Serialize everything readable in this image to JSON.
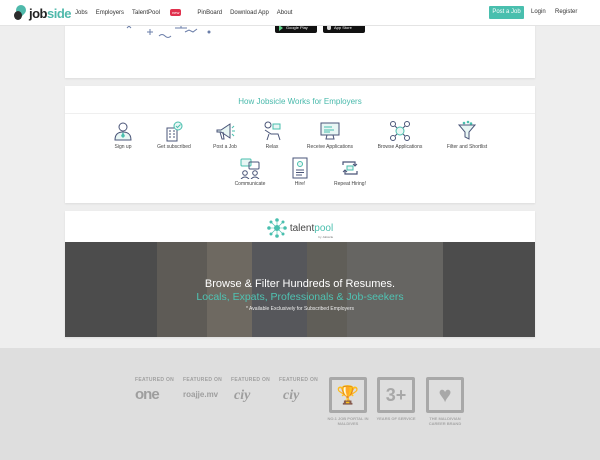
{
  "nav": {
    "logo_job": "job",
    "logo_side": "side",
    "links": [
      "Jobs",
      "Employers",
      "TalentPool",
      "PinBoard",
      "Download App",
      "About"
    ],
    "talentpool_badge": "new",
    "post_job": "Post a Job",
    "login": "Login",
    "register": "Register"
  },
  "app": {
    "google_play": "Google Play",
    "app_store": "App Store"
  },
  "how": {
    "title": "How Jobsicle Works for Employers",
    "steps": [
      {
        "label": "Sign up",
        "icon": "user-icon"
      },
      {
        "label": "Get subscribed",
        "icon": "building-check-icon"
      },
      {
        "label": "Post a Job",
        "icon": "megaphone-icon"
      },
      {
        "label": "Relax",
        "icon": "relax-icon"
      },
      {
        "label": "Receive Applications",
        "icon": "monitor-icon"
      },
      {
        "label": "Browse Applications",
        "icon": "people-network-icon"
      },
      {
        "label": "Filter and Shortlist",
        "icon": "filter-icon"
      },
      {
        "label": "Communicate",
        "icon": "chat-icon"
      },
      {
        "label": "Hire!",
        "icon": "document-icon"
      },
      {
        "label": "Repeat Hiring!",
        "icon": "repeat-icon"
      }
    ]
  },
  "talentpool": {
    "logo_talent": "talent",
    "logo_pool": "pool",
    "logo_by": "by Jobsicle",
    "headline": "Browse & Filter Hundreds of Resumes.",
    "subheadline": "Locals, Expats, Professionals & Job-seekers",
    "note": "* Available Exclusively for Subscribed Employers"
  },
  "footer": {
    "featured_on": "FEATURED ON",
    "press": [
      "one",
      "roajje.mv",
      "ciy",
      "ciy"
    ],
    "awards": [
      {
        "symbol": "🏆",
        "caption": "NO.1 JOB PORTAL IN MALDIVES"
      },
      {
        "symbol": "3+",
        "caption": "YEARS OF SERVICE"
      },
      {
        "symbol": "♥",
        "caption": "THE MALDIVIAN CAREER BRAND"
      }
    ]
  },
  "colors": {
    "accent": "#49bfae",
    "badge": "#e0314d"
  }
}
